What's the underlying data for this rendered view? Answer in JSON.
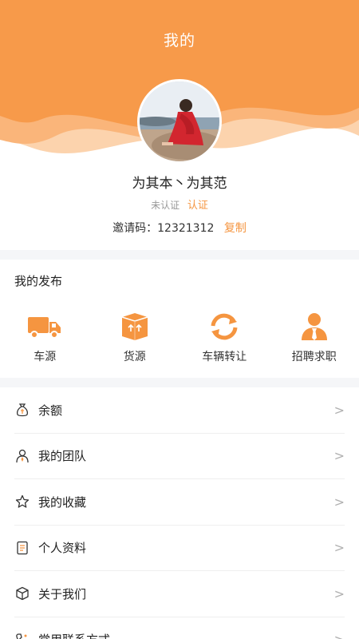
{
  "header": {
    "title": "我的"
  },
  "profile": {
    "username": "为其本丶为其范",
    "status": "未认证",
    "verify_link": "认证",
    "invite_label": "邀请码：",
    "invite_code": "12321312",
    "copy_label": "复制"
  },
  "posts": {
    "title": "我的发布",
    "items": [
      {
        "label": "车源",
        "icon": "truck-icon"
      },
      {
        "label": "货源",
        "icon": "cargo-box-icon"
      },
      {
        "label": "车辆转让",
        "icon": "transfer-arrows-icon"
      },
      {
        "label": "招聘求职",
        "icon": "recruit-person-icon"
      }
    ]
  },
  "menu": {
    "arrow": ">",
    "items": [
      {
        "label": "余额",
        "icon": "money-bag-icon"
      },
      {
        "label": "我的团队",
        "icon": "team-icon"
      },
      {
        "label": "我的收藏",
        "icon": "star-icon"
      },
      {
        "label": "个人资料",
        "icon": "profile-doc-icon"
      },
      {
        "label": "关于我们",
        "icon": "box-icon"
      },
      {
        "label": "常用联系方式",
        "icon": "phone-icon"
      }
    ]
  },
  "colors": {
    "accent": "#f59540",
    "wave_light": "#fbc596"
  }
}
